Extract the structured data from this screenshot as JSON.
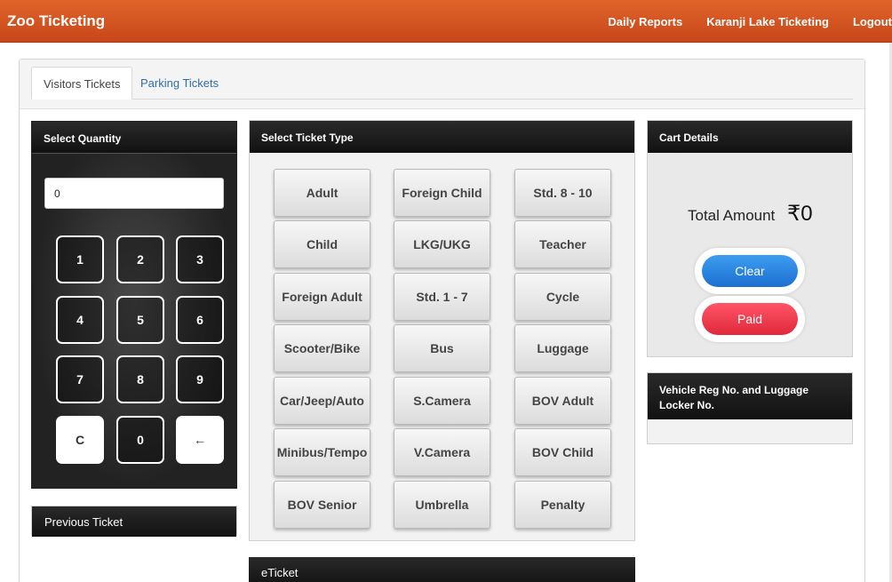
{
  "navbar": {
    "brand": "Zoo Ticketing",
    "links": [
      "Daily Reports",
      "Karanji Lake Ticketing",
      "Logout"
    ]
  },
  "tabs": [
    {
      "label": "Visitors Tickets",
      "active": true
    },
    {
      "label": "Parking Tickets",
      "active": false
    }
  ],
  "quantity": {
    "title": "Select Quantity",
    "value": "0",
    "keys": [
      "1",
      "2",
      "3",
      "4",
      "5",
      "6",
      "7",
      "8",
      "9",
      "C",
      "0",
      "←"
    ]
  },
  "previous_ticket": {
    "title": "Previous Ticket"
  },
  "ticket_types": {
    "title": "Select Ticket Type",
    "items": [
      "Adult",
      "Foreign Child",
      "Std. 8 - 10",
      "Child",
      "LKG/UKG",
      "Teacher",
      "Foreign Adult",
      "Std. 1 - 7",
      "Cycle",
      "Scooter/Bike",
      "Bus",
      "Luggage",
      "Car/Jeep/Auto",
      "S.Camera",
      "BOV Adult",
      "Minibus/Tempo",
      "V.Camera",
      "BOV Child",
      "BOV Senior",
      "Umbrella",
      "Penalty"
    ]
  },
  "eticket": {
    "title": "eTicket"
  },
  "cart": {
    "title": "Cart Details",
    "total_label": "Total Amount",
    "total_value": "₹0",
    "clear_label": "Clear",
    "paid_label": "Paid"
  },
  "vehicle": {
    "title": "Vehicle Reg No. and Luggage Locker No."
  },
  "colors": {
    "navbar": "#d4531f",
    "clear": "#1c6fd0",
    "paid": "#e0283c",
    "panel_header": "#1a1a1a"
  }
}
